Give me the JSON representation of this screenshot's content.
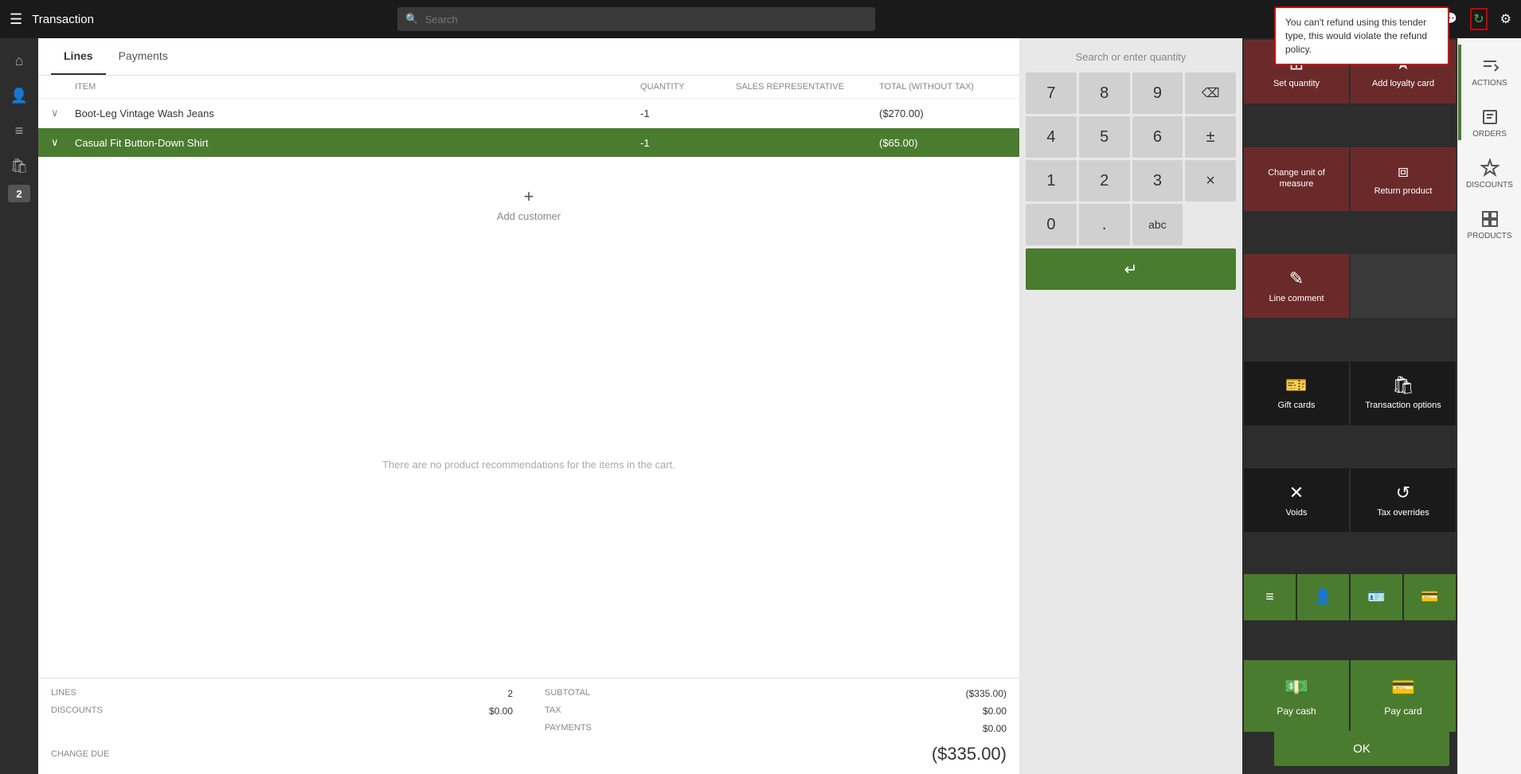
{
  "topbar": {
    "title": "Transaction",
    "search_placeholder": "Search"
  },
  "tabs": {
    "lines": "Lines",
    "payments": "Payments"
  },
  "table": {
    "columns": [
      "",
      "ITEM",
      "QUANTITY",
      "SALES REPRESENTATIVE",
      "TOTAL (WITHOUT TAX)"
    ],
    "rows": [
      {
        "expanded": true,
        "item": "Boot-Leg Vintage Wash Jeans",
        "quantity": "-1",
        "rep": "",
        "total": "($270.00)",
        "selected": false
      },
      {
        "expanded": true,
        "item": "Casual Fit Button-Down Shirt",
        "quantity": "-1",
        "rep": "",
        "total": "($65.00)",
        "selected": true
      }
    ]
  },
  "add_customer_label": "Add customer",
  "recommendations_text": "There are no product recommendations for the items in the cart.",
  "summary": {
    "lines_label": "LINES",
    "lines_value": "2",
    "discounts_label": "DISCOUNTS",
    "discounts_value": "$0.00",
    "subtotal_label": "SUBTOTAL",
    "subtotal_value": "($335.00)",
    "tax_label": "TAX",
    "tax_value": "$0.00",
    "payments_label": "PAYMENTS",
    "payments_value": "$0.00",
    "change_due_label": "CHANGE DUE",
    "change_due_value": "($335.00)"
  },
  "numpad": {
    "display": "Search or enter quantity",
    "keys": [
      "7",
      "8",
      "9",
      "⌫",
      "4",
      "5",
      "6",
      "±",
      "1",
      "2",
      "3",
      "×",
      "0",
      ".",
      "abc"
    ],
    "enter_label": "↵"
  },
  "action_buttons": {
    "set_quantity": "Set quantity",
    "add_loyalty_card": "Add loyalty card",
    "change_unit": "Change unit of measure",
    "return_product": "Return product",
    "line_comment": "Line comment",
    "gift_cards": "Gift cards",
    "transaction_options": "Transaction options",
    "voids": "Voids",
    "tax_overrides": "Tax overrides",
    "pay_cash": "Pay cash",
    "pay_card": "Pay card"
  },
  "right_sidebar": {
    "actions": "ACTIONS",
    "orders": "ORDERS",
    "discounts": "DISCOUNTS",
    "products": "PRODUCTS"
  },
  "alert": {
    "message": "You can't refund using this tender type, this would violate the refund policy."
  },
  "ok_button": "OK"
}
